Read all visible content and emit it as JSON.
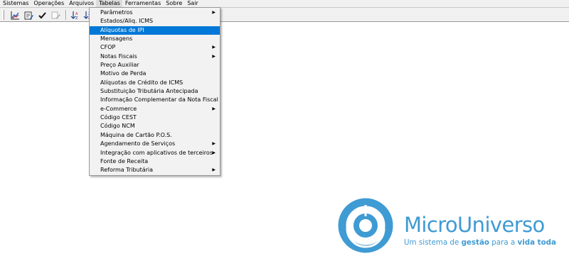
{
  "menubar": {
    "items": [
      "Sistemas",
      "Operações",
      "Arquivos",
      "Tabelas",
      "Ferramentas",
      "Sobre",
      "Sair"
    ]
  },
  "toolbar": {
    "buttons": [
      {
        "icon": "chart-icon"
      },
      {
        "icon": "edit-form-icon"
      },
      {
        "icon": "checkmark-icon"
      },
      {
        "icon": "edit-doc-icon"
      },
      {
        "icon": "sort-icon"
      },
      {
        "icon": "sort-icon"
      }
    ]
  },
  "dropdown": {
    "items": [
      {
        "label": "Parâmetros",
        "submenu": true
      },
      {
        "label": "Estados/Aliq. ICMS",
        "submenu": false
      },
      {
        "label": "Alíquotas de IPI",
        "submenu": false,
        "highlighted": true
      },
      {
        "label": "Mensagens",
        "submenu": false
      },
      {
        "label": "CFOP",
        "submenu": true
      },
      {
        "label": "Notas Fiscais",
        "submenu": true
      },
      {
        "label": "Preço  Auxiliar",
        "submenu": false
      },
      {
        "label": "Motivo de Perda",
        "submenu": false
      },
      {
        "label": "Alíquotas de Crédito de ICMS",
        "submenu": false
      },
      {
        "label": "Substituição Tributária Antecipada",
        "submenu": false
      },
      {
        "label": "Informação Complementar da Nota Fiscal",
        "submenu": false
      },
      {
        "label": "e-Commerce",
        "submenu": true
      },
      {
        "label": "Código CEST",
        "submenu": false
      },
      {
        "label": "Código NCM",
        "submenu": false
      },
      {
        "label": "Máquina de Cartão P.O.S.",
        "submenu": false
      },
      {
        "label": "Agendamento de Serviços",
        "submenu": true
      },
      {
        "label": "Integração com aplicativos de terceiros",
        "submenu": true
      },
      {
        "label": "Fonte de Receita",
        "submenu": false
      },
      {
        "label": "Reforma Tributária",
        "submenu": true
      }
    ],
    "arrow": "▶"
  },
  "logo": {
    "name": "MicroUniverso",
    "tagline_1": "Um sistema de ",
    "tagline_bold": "gestão",
    "tagline_2": " para a ",
    "tagline_bold_2": "vida toda",
    "color": "#3f9bd3"
  }
}
